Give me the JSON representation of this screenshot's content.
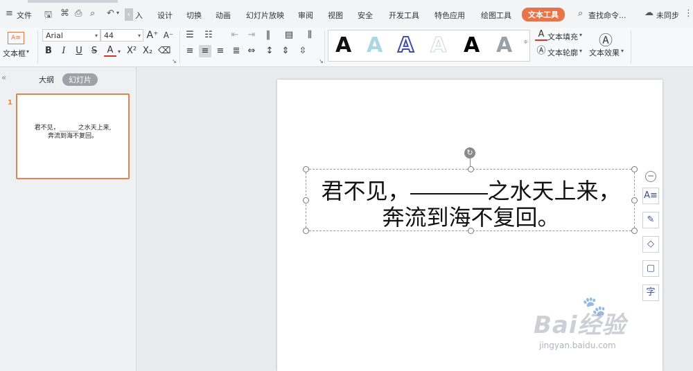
{
  "menu": {
    "file_label": "文件",
    "truncated_tab": "入",
    "tabs": [
      "设计",
      "切换",
      "动画",
      "幻灯片放映",
      "审阅",
      "视图",
      "安全",
      "开发工具",
      "特色应用",
      "绘图工具"
    ],
    "active_tab": "文本工具",
    "search_label": "查找命令...",
    "sync_label": "未同步"
  },
  "ribbon": {
    "textbox_label": "文本框",
    "font_name": "Arial",
    "font_size": "44",
    "text_fill_label": "文本填充",
    "text_outline_label": "文本轮廓",
    "text_effect_label": "文本效果",
    "style_glyph": "A",
    "colors": {
      "accent": "#e8744a",
      "font_color_underline": "#d9342b",
      "gallery_fill_1": "#111111",
      "gallery_fill_2": "#a9d8e0",
      "gallery_fill_3": "#3d4fa8"
    }
  },
  "left_panel": {
    "outline_tab": "大纲",
    "slides_tab": "幻灯片",
    "slide_number": "1",
    "thumb_line1": "君不见，______之水天上来,",
    "thumb_line2": "奔流到海不复回。"
  },
  "slide": {
    "line1_before": "君不见，",
    "line1_after": "之水天上来，",
    "line2": "奔流到海不复回。"
  },
  "side_tools": {
    "collapse_glyph": "−",
    "char_glyph": "字"
  },
  "watermark": {
    "brand": "Bai经验",
    "url": "jingyan.baidu.com"
  }
}
